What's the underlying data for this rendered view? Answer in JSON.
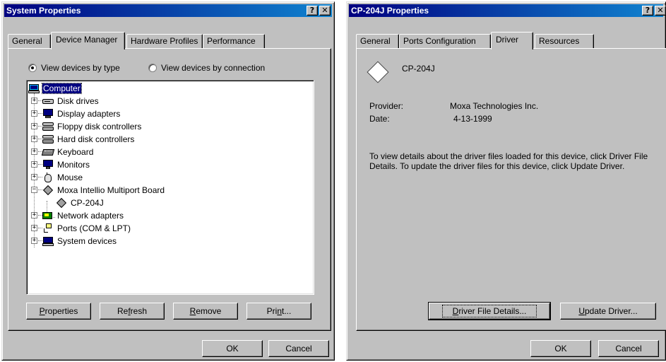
{
  "system_properties": {
    "title": "System Properties",
    "help_glyph": "?",
    "close_glyph": "✕",
    "tabs": [
      "General",
      "Device Manager",
      "Hardware Profiles",
      "Performance"
    ],
    "view_by_type_label": "View devices by type",
    "view_by_connection_label": "View devices by connection",
    "tree": [
      {
        "label": "Computer",
        "icon": "computer-icon"
      },
      {
        "label": "Disk drives",
        "icon": "disk-drive-icon"
      },
      {
        "label": "Display adapters",
        "icon": "display-adapter-icon"
      },
      {
        "label": "Floppy disk controllers",
        "icon": "floppy-controller-icon"
      },
      {
        "label": "Hard disk controllers",
        "icon": "hard-disk-controller-icon"
      },
      {
        "label": "Keyboard",
        "icon": "keyboard-icon"
      },
      {
        "label": "Monitors",
        "icon": "monitor-icon"
      },
      {
        "label": "Mouse",
        "icon": "mouse-icon"
      },
      {
        "label": "Moxa Intellio Multiport Board",
        "icon": "multiport-board-icon"
      },
      {
        "label": "CP-204J",
        "icon": "multiport-board-icon"
      },
      {
        "label": "Network adapters",
        "icon": "network-adapter-icon"
      },
      {
        "label": "Ports (COM & LPT)",
        "icon": "port-icon"
      },
      {
        "label": "System devices",
        "icon": "system-devices-icon"
      }
    ],
    "properties_button": {
      "pre": "",
      "key": "P",
      "post": "roperties"
    },
    "refresh_button": {
      "pre": "Re",
      "key": "f",
      "post": "resh"
    },
    "remove_button": {
      "pre": "",
      "key": "R",
      "post": "emove"
    },
    "print_button": {
      "pre": "Pri",
      "key": "n",
      "post": "t..."
    },
    "ok_label": "OK",
    "cancel_label": "Cancel"
  },
  "device_properties": {
    "title": "CP-204J Properties",
    "help_glyph": "?",
    "close_glyph": "✕",
    "tabs": [
      "General",
      "Ports Configuration",
      "Driver",
      "Resources"
    ],
    "device_name": "CP-204J",
    "provider_label": "Provider:",
    "provider_value": "Moxa Technologies Inc.",
    "date_label": "Date:",
    "date_value": "4-13-1999",
    "description": "To view details about the driver files loaded for this device, click Driver File Details.  To update the driver files for this device, click Update Driver.",
    "driver_file_details_button": {
      "pre": "",
      "key": "D",
      "post": "river File Details..."
    },
    "update_driver_button": {
      "pre": "",
      "key": "U",
      "post": "pdate Driver..."
    },
    "ok_label": "OK",
    "cancel_label": "Cancel"
  }
}
